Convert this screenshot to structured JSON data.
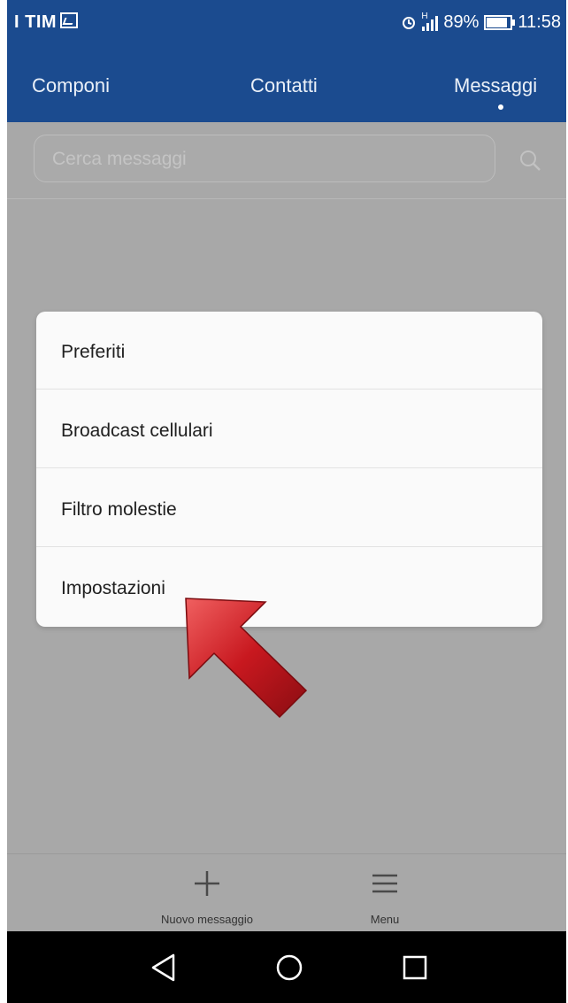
{
  "status_bar": {
    "carrier": "I TIM",
    "network": "H",
    "battery": "89%",
    "battery_level": 0.89,
    "time": "11:58"
  },
  "tabs": [
    {
      "label": "Componi"
    },
    {
      "label": "Contatti"
    },
    {
      "label": "Messaggi"
    }
  ],
  "active_tab": "Messaggi",
  "search": {
    "placeholder": "Cerca messaggi"
  },
  "menu": {
    "items": [
      {
        "label": "Preferiti"
      },
      {
        "label": "Broadcast cellulari"
      },
      {
        "label": "Filtro molestie"
      },
      {
        "label": "Impostazioni"
      }
    ]
  },
  "bottom_toolbar": {
    "new_message_label": "Nuovo messaggio",
    "menu_label": "Menu"
  },
  "icons": {
    "arrow_color": "#c8181f",
    "brand_color": "#1b4b8f"
  }
}
